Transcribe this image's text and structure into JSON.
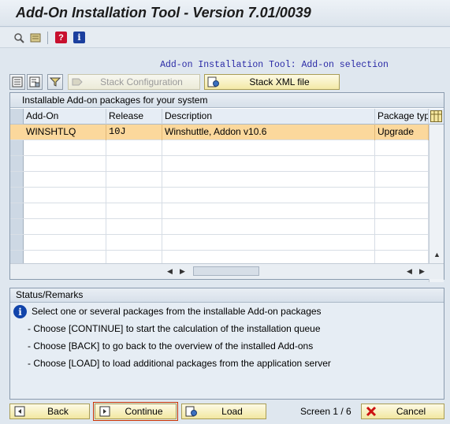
{
  "window": {
    "title": "Add-On Installation Tool - Version 7.01/0039"
  },
  "toolbar": {
    "icons": [
      "search-icon",
      "settings-icon",
      "help-icon",
      "info-icon"
    ],
    "help_glyph": "?",
    "info_glyph": "i"
  },
  "heading": "Add-on Installation Tool: Add-on selection",
  "buttons": {
    "stack_configuration": "Stack Configuration",
    "stack_xml_file": "Stack XML file"
  },
  "table": {
    "caption": "Installable Add-on packages for your system",
    "columns": [
      "Add-On",
      "Release",
      "Description",
      "Package type"
    ],
    "rows": [
      {
        "addon": "WINSHTLQ",
        "release": "10J",
        "description": "Winshuttle, Addon v10.6",
        "package_type": "Upgrade",
        "selected": true
      }
    ],
    "empty_rows": 8
  },
  "status": {
    "caption": "Status/Remarks",
    "lines": [
      "Select one or several packages from the installable Add-on packages",
      "- Choose [CONTINUE] to start the calculation of the installation queue",
      "- Choose [BACK] to go back to the overview of the installed Add-ons",
      "- Choose [LOAD] to load additional packages from the application server"
    ]
  },
  "footer": {
    "back": "Back",
    "continue": "Continue",
    "load": "Load",
    "screen": "Screen 1 / 6",
    "cancel": "Cancel"
  },
  "colors": {
    "selected_row": "#fbd89c",
    "button_face": "#f3e9a6",
    "heading_text": "#2a2aa6",
    "cancel_icon": "#cc1111"
  }
}
